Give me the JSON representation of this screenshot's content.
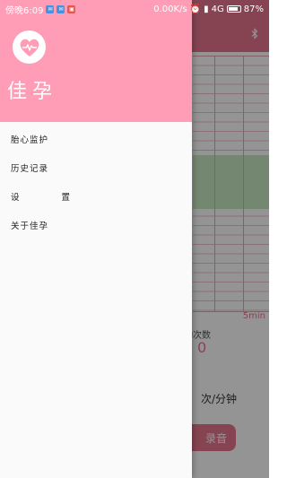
{
  "status_bar": {
    "time": "傍晚6:09",
    "net_speed": "0.00K/s",
    "network": "4G",
    "battery": "87%",
    "battery_level": 0.87
  },
  "drawer": {
    "app_name": "佳孕",
    "menu": [
      {
        "label": "胎心监护"
      },
      {
        "label": "历史记录"
      },
      {
        "label": "设 置"
      },
      {
        "label": "关于佳孕"
      }
    ]
  },
  "background_app": {
    "chart_duration_label": "5min",
    "kick_count_label": "动次数",
    "kick_count_value": "0",
    "rate_unit": "次/分钟",
    "record_button": "录音"
  },
  "colors": {
    "drawer_header": "#ff9cb6",
    "toolbar": "#e7768d",
    "accent": "#e7768d"
  },
  "icons": {
    "logo": "heart-pulse-icon",
    "bluetooth": "bluetooth-icon"
  }
}
